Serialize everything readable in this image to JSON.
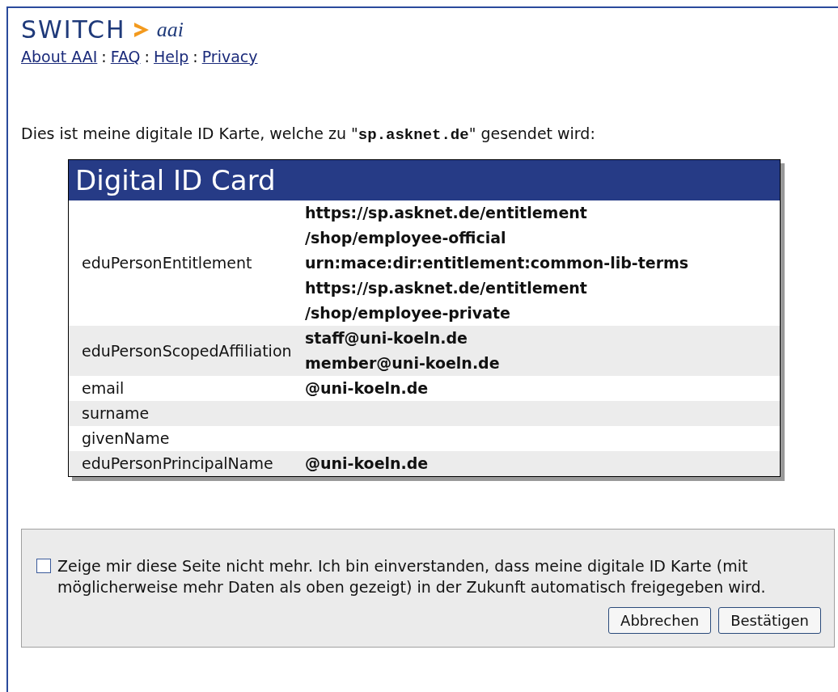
{
  "logo": {
    "brand": "SWITCH",
    "product": "aai"
  },
  "nav_links": [
    "About AAI",
    "FAQ",
    "Help",
    "Privacy"
  ],
  "nav_separator": ":",
  "intro": {
    "before": "Dies ist meine digitale ID Karte, welche zu \"",
    "host": "sp.asknet.de",
    "after": "\" gesendet wird:"
  },
  "card": {
    "title": "Digital ID Card",
    "rows": [
      {
        "name": "eduPersonEntitlement",
        "values": [
          "https://sp.asknet.de/entitlement",
          "/shop/employee-official",
          "urn:mace:dir:entitlement:common-lib-terms",
          "https://sp.asknet.de/entitlement",
          "/shop/employee-private"
        ]
      },
      {
        "name": "eduPersonScopedAffiliation",
        "values": [
          "staff@uni-koeln.de",
          "member@uni-koeln.de"
        ]
      },
      {
        "name": "email",
        "values": [
          "@uni-koeln.de"
        ]
      },
      {
        "name": "surname",
        "values": []
      },
      {
        "name": "givenName",
        "values": []
      },
      {
        "name": "eduPersonPrincipalName",
        "values": [
          "@uni-koeln.de"
        ]
      }
    ]
  },
  "consent": {
    "checked": false,
    "text": "Zeige mir diese Seite nicht mehr. Ich bin einverstanden, dass meine digitale ID Karte (mit möglicherweise mehr Daten als oben gezeigt) in der Zukunft automatisch freigegeben wird.",
    "buttons": [
      "Abbrechen",
      "Bestätigen"
    ]
  }
}
